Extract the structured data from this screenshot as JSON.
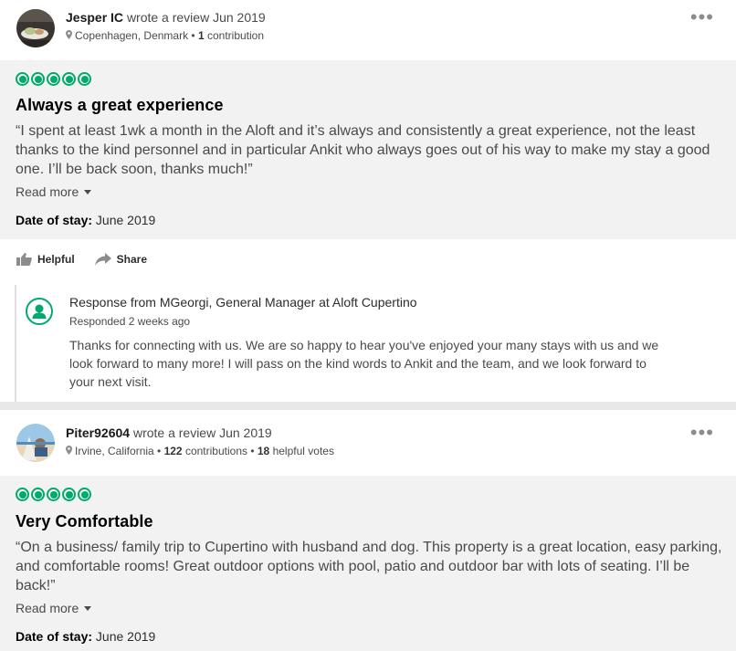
{
  "reviews": [
    {
      "reviewer": "Jesper IC",
      "action": "wrote a review Jun 2019",
      "location": "Copenhagen, Denmark",
      "contributions_count": "1",
      "contributions_label": "contribution",
      "helpful_votes_count": "",
      "helpful_votes_label": "",
      "rating": 5,
      "title": "Always a great experience",
      "text": "“I spent at least 1wk a month in the Aloft and it’s always and consistently a great experience, not the least thanks to the kind personnel and in particular Ankit who always goes out of his way to make my stay a good one. I’ll be back soon, thanks much!”",
      "read_more": "Read more",
      "stay_label": "Date of stay:",
      "stay_value": "June 2019",
      "helpful_label": "Helpful",
      "share_label": "Share",
      "response": {
        "from": "Response from MGeorgi, General Manager at Aloft Cupertino",
        "date": "Responded 2 weeks ago",
        "text": "Thanks for connecting with us. We are so happy to hear you've enjoyed your many stays with us and we look forward to many more! I will pass on the kind words to Ankit and the team, and we look forward to your next visit."
      }
    },
    {
      "reviewer": "Piter92604",
      "action": "wrote a review Jun 2019",
      "location": "Irvine, California",
      "contributions_count": "122",
      "contributions_label": "contributions",
      "helpful_votes_count": "18",
      "helpful_votes_label": "helpful votes",
      "rating": 5,
      "title": "Very Comfortable",
      "text": "“On a business/ family trip to Cupertino with husband and dog. This property is a great location, easy parking, and comfortable rooms! Great outdoor options with pool, patio and outdoor bar with lots of seating. I’ll be back!”",
      "read_more": "Read more",
      "stay_label": "Date of stay:",
      "stay_value": "June 2019"
    }
  ],
  "ui": {
    "more_icon": "more-dots-icon",
    "location_icon": "map-pin-icon",
    "helpful_icon": "thumbs-up-icon",
    "share_icon": "share-arrow-icon",
    "accent_color": "#00aa6c"
  }
}
